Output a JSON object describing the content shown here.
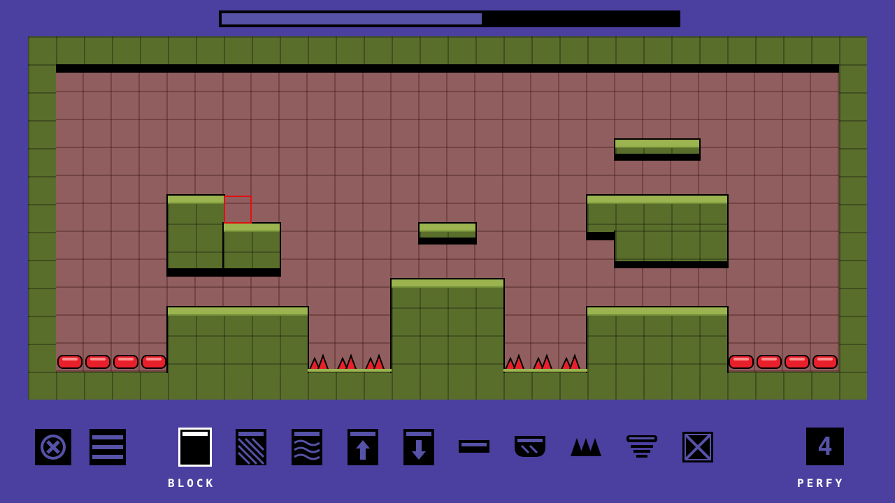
{
  "level": {
    "progress": 0.57,
    "colors": {
      "background": "#4b3fa0",
      "wall": "#5a6e2c",
      "room": "#905e5e",
      "grass": "#9bb44f",
      "hazard": "#e8202c",
      "cursor": "#e01010"
    }
  },
  "toolbar": {
    "tools": [
      {
        "icon": "close-circle-icon"
      },
      {
        "icon": "menu-icon"
      },
      {
        "icon": "block-tile-icon"
      },
      {
        "icon": "slope-tile-icon"
      },
      {
        "icon": "water-tile-icon"
      },
      {
        "icon": "up-arrow-tile-icon"
      },
      {
        "icon": "down-arrow-tile-icon"
      },
      {
        "icon": "thin-platform-icon"
      },
      {
        "icon": "bounce-pad-icon"
      },
      {
        "icon": "spikes-icon"
      },
      {
        "icon": "spring-icon"
      },
      {
        "icon": "eraser-x-icon"
      }
    ],
    "selected_tool_label": "BLOCK",
    "counter_value": "4",
    "counter_label": "PERFY"
  }
}
